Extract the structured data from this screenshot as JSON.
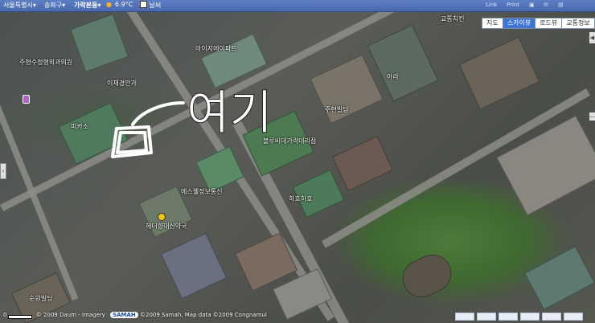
{
  "topbar": {
    "city": "서울특별시",
    "city_arrow": "▾",
    "district": "송파구",
    "district_arrow": "▾",
    "neighborhood": "가락본동",
    "neighborhood_arrow": "▾",
    "temperature": "6.9°C",
    "weather_check_label": "날씨",
    "right_icons": [
      "Link",
      "Print",
      "▣",
      "✉",
      "▤"
    ]
  },
  "view_tabs": [
    {
      "label": "지도",
      "active": false
    },
    {
      "label": "스카이뷰",
      "active": true
    },
    {
      "label": "로드뷰",
      "active": false
    },
    {
      "label": "교통정보",
      "active": false
    }
  ],
  "scroll_arrow": "◀",
  "left_handle": "‹",
  "right_handle": "—",
  "annotation": "여기",
  "place_labels": [
    {
      "name": "교통치킨"
    },
    {
      "name": "아이지에이파트"
    },
    {
      "name": "주형수정형외과의원"
    },
    {
      "name": "이재경안과"
    },
    {
      "name": "아라"
    },
    {
      "name": "주현빌딩"
    },
    {
      "name": "피카소"
    },
    {
      "name": "블루비데가락대리점"
    },
    {
      "name": "에스웰정보통신"
    },
    {
      "name": "하호하호"
    },
    {
      "name": "헤더향대신약국"
    },
    {
      "name": "순원빌딩"
    }
  ],
  "footer": {
    "scale": "0",
    "copyright": "© 2009 Daum - Imagery",
    "provider_logo": "SAMAH",
    "attribution": "©2009 Samah, Map data ©2009 Congnamul"
  },
  "colors": {
    "topbar": "#4a69ae",
    "active_tab": "#3f74d1",
    "annotation": "#ffffff"
  }
}
